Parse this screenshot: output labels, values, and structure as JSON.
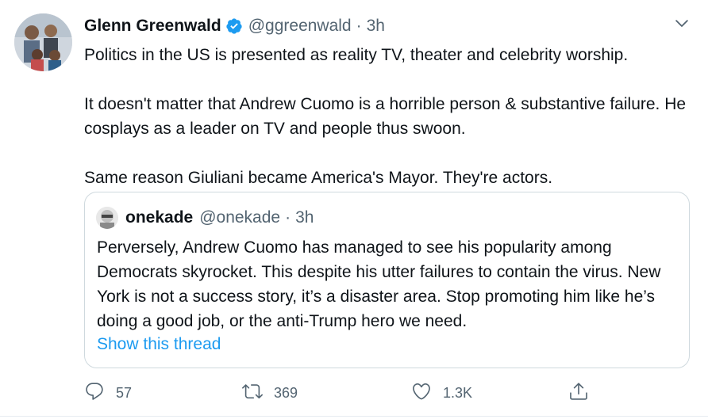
{
  "author": {
    "name": "Glenn Greenwald",
    "handle": "@ggreenwald",
    "separator": "·",
    "time": "3h",
    "verified_color": "#1d9bf0"
  },
  "tweet": {
    "text": "Politics in the US is presented as reality TV, theater and celebrity worship.\n\nIt doesn't matter that Andrew Cuomo is a horrible person & substantive failure. He cosplays as a leader on TV and people thus swoon.\n\nSame reason Giuliani became America's Mayor. They're actors."
  },
  "quote": {
    "name": "onekade",
    "handle": "@onekade",
    "separator": "·",
    "time": "3h",
    "text": "Perversely, Andrew Cuomo has managed to see his popularity among Democrats skyrocket. This despite his utter failures to contain the virus. New York is not a success story, it’s a disaster area. Stop promoting him like he’s doing a good job, or the anti-Trump hero we need.",
    "link": "Show this thread"
  },
  "actions": {
    "reply_count": "57",
    "retweet_count": "369",
    "like_count": "1.3K"
  },
  "colors": {
    "text": "#0f1419",
    "secondary": "#536471",
    "link": "#1d9bf0",
    "border": "#cfd9de"
  },
  "icons": [
    "verified-badge-icon",
    "chevron-down-icon",
    "reply-icon",
    "retweet-icon",
    "like-icon",
    "share-icon"
  ]
}
